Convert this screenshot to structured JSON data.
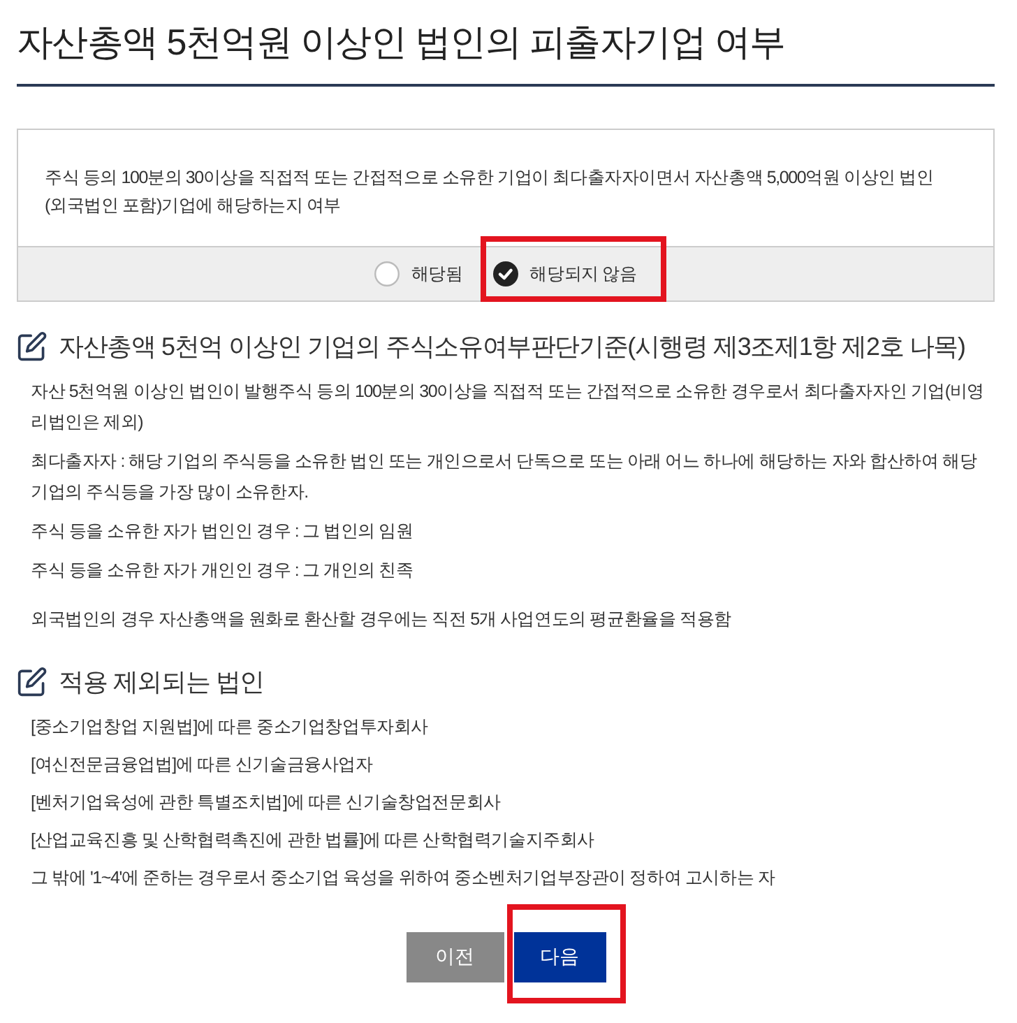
{
  "page_title": "자산총액 5천억원 이상인 법인의 피출자기업 여부",
  "question": {
    "text": "주식 등의 100분의 30이상을 직접적 또는 간접적으로 소유한 기업이 최다출자자이면서 자산총액 5,000억원 이상인 법인(외국법인 포함)기업에 해당하는지 여부",
    "options": [
      {
        "label": "해당됨",
        "selected": false,
        "highlighted": false
      },
      {
        "label": "해당되지 않음",
        "selected": true,
        "highlighted": true
      }
    ]
  },
  "criteria": {
    "heading": "자산총액 5천억 이상인 기업의 주식소유여부판단기준(시행령 제3조제1항 제2호 나목)",
    "paragraphs": [
      "자산 5천억원 이상인 법인이 발행주식 등의 100분의 30이상을 직접적 또는 간접적으로 소유한 경우로서 최다출자자인 기업(비영리법인은 제외)",
      "최다출자자 : 해당 기업의 주식등을 소유한 법인 또는 개인으로서 단독으로 또는 아래 어느 하나에 해당하는 자와 합산하여 해당 기업의 주식등을 가장 많이 소유한자.",
      "주식 등을 소유한 자가 법인인 경우 : 그 법인의 임원",
      "주식 등을 소유한 자가 개인인 경우 : 그 개인의 친족"
    ],
    "note": "외국법인의 경우 자산총액을 원화로 환산할 경우에는 직전 5개 사업연도의 평균환율을 적용함"
  },
  "exclusions": {
    "heading": "적용 제외되는 법인",
    "items": [
      "[중소기업창업 지원법]에 따른 중소기업창업투자회사",
      "[여신전문금융업법]에 따른 신기술금융사업자",
      "[벤처기업육성에 관한 특별조치법]에 따른 신기술창업전문회사",
      "[산업교육진흥 및 산학협력촉진에 관한 법률]에 따른 산학협력기술지주회사",
      "그 밖에 '1~4'에 준하는 경우로서 중소기업 육성을 위하여 중소벤처기업부장관이 정하여 고시하는 자"
    ]
  },
  "buttons": [
    {
      "label": "이전",
      "kind": "secondary",
      "highlighted": false
    },
    {
      "label": "다음",
      "kind": "primary",
      "highlighted": true
    }
  ]
}
